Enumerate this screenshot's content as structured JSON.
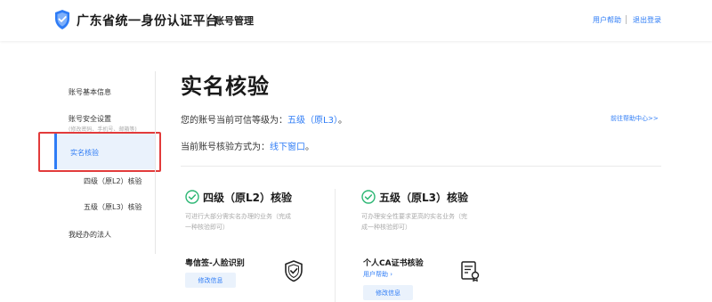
{
  "header": {
    "brand": "广东省统一身份认证平台",
    "section": "账号管理",
    "help_link": "用户帮助",
    "logout_link": "退出登录"
  },
  "sidebar": {
    "items": [
      {
        "label": "账号基本信息"
      },
      {
        "label": "账号安全设置",
        "sub": "(修改密码、手机号、邮箱等)"
      },
      {
        "label": "实名核验"
      },
      {
        "label": "四级（原L2）核验"
      },
      {
        "label": "五级（原L3）核验"
      },
      {
        "label": "我经办的法人"
      }
    ]
  },
  "main": {
    "title": "实名核验",
    "level_prefix": "您的账号当前可信等级为：",
    "level_value": "五级（原L3）",
    "level_suffix": "。",
    "method_prefix": "当前账号核验方式为：",
    "method_value": "线下窗口",
    "method_suffix": "。",
    "help_center": "前往帮助中心>>",
    "levels": [
      {
        "title": "四级（原L2）核验",
        "desc_line1": "可进行大部分需实名办理的业务（完成",
        "desc_line2": "一种核验即可）",
        "method": "粤信签-人脸识别",
        "button": "修改信息"
      },
      {
        "title": "五级（原L3）核验",
        "desc_line1": "可办理安全性要求更高的实名业务（完",
        "desc_line2": "成一种核验即可）",
        "method": "个人CA证书核验",
        "link": "用户帮助 ›",
        "button": "修改信息"
      }
    ]
  },
  "colors": {
    "accent": "#2e7cf6",
    "highlight_border": "#e23b3b",
    "active_bg": "#eaf2fc",
    "check_green": "#2bb673"
  },
  "icons": {
    "logo": "shield-check-icon",
    "level_check": "check-circle-icon",
    "face_method": "shield-check-icon",
    "ca_method": "certificate-icon"
  }
}
